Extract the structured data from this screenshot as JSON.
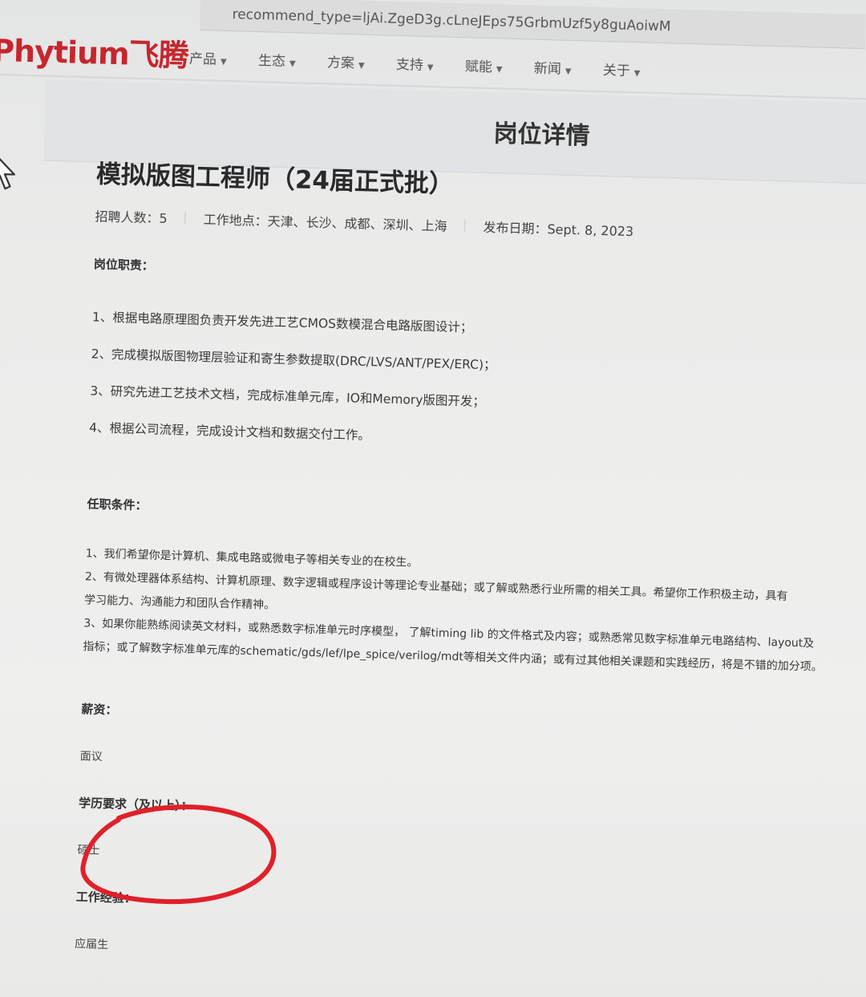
{
  "browser": {
    "url_fragment": "recommend_type=ljAi.ZgeD3g.cLneJEps75GrbmUzf5y8guAoiwM"
  },
  "nav": {
    "logo": "Phytium飞腾",
    "items": [
      {
        "label": "产品"
      },
      {
        "label": "生态"
      },
      {
        "label": "方案"
      },
      {
        "label": "支持"
      },
      {
        "label": "赋能"
      },
      {
        "label": "新闻"
      },
      {
        "label": "关于"
      }
    ]
  },
  "page": {
    "heading": "岗位详情"
  },
  "job": {
    "title": "模拟版图工程师（24届正式批）",
    "headcount": "招聘人数：5",
    "location": "工作地点：天津、长沙、成都、深圳、上海",
    "publish_date": "发布日期：Sept. 8, 2023",
    "duties_title": "岗位职责：",
    "duties": [
      "1、根据电路原理图负责开发先进工艺CMOS数模混合电路版图设计；",
      "2、完成模拟版图物理层验证和寄生参数提取(DRC/LVS/ANT/PEX/ERC)；",
      "3、研究先进工艺技术文档，完成标准单元库，IO和Memory版图开发；",
      "4、根据公司流程，完成设计文档和数据交付工作。"
    ],
    "requirements_title": "任职条件：",
    "requirements": [
      "1、我们希望你是计算机、集成电路或微电子等相关专业的在校生。",
      "2、有微处理器体系结构、计算机原理、数字逻辑或程序设计等理论专业基础；或了解或熟悉行业所需的相关工具。希望你工作积极主动，具有",
      "学习能力、沟通能力和团队合作精神。",
      "3、如果你能熟练阅读英文材料，或熟悉数字标准单元时序模型， 了解timing lib 的文件格式及内容；或熟悉常见数字标准单元电路结构、layout及",
      "指标；或了解数字标准单元库的schematic/gds/lef/lpe_spice/verilog/mdt等相关文件内涵；或有过其他相关课题和实践经历，将是不错的加分项。"
    ],
    "salary_title": "薪资：",
    "salary": "面议",
    "education_title": "学历要求（及以上）：",
    "education": "硕士",
    "experience_title": "工作经验：",
    "experience": "应届生"
  },
  "colors": {
    "brand": "#c6262e",
    "annotation": "#e0202a"
  },
  "icons": {
    "cursor": "mouse-pointer-icon",
    "nav_caret": "caret-down-icon"
  }
}
